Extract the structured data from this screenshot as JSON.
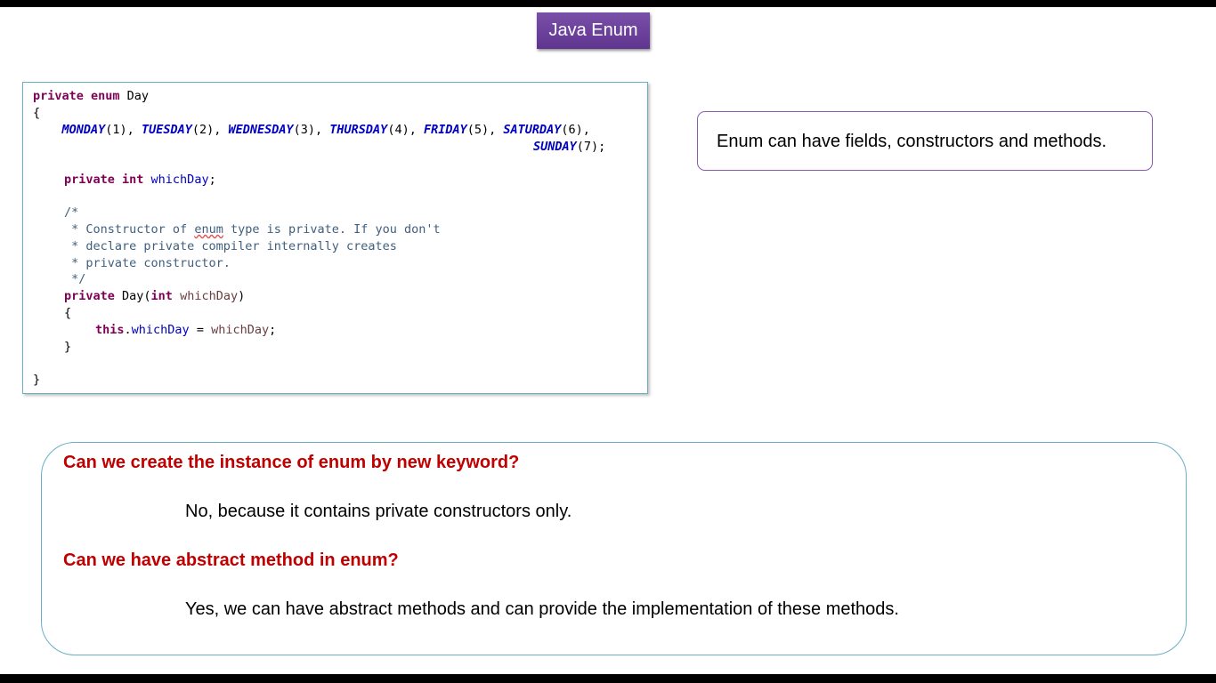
{
  "title": "Java Enum",
  "code": {
    "l01": {
      "kw": "private enum",
      "t": " Day"
    },
    "l02": "{",
    "l03": {
      "pre": "    ",
      "items": [
        {
          "name": "MONDAY",
          "arg": "(1), "
        },
        {
          "name": "TUESDAY",
          "arg": "(2), "
        },
        {
          "name": "WEDNESDAY",
          "arg": "(3), "
        },
        {
          "name": "THURSDAY",
          "arg": "(4), "
        },
        {
          "name": "FRIDAY",
          "arg": "(5), "
        },
        {
          "name": "SATURDAY",
          "arg": "(6),"
        }
      ]
    },
    "l04": {
      "name": "SUNDAY",
      "arg": "(7);"
    },
    "l05": {
      "kw": "private int",
      "field": "whichDay",
      "end": ";"
    },
    "l06": "/*",
    "l07": {
      "a": " * Constructor of ",
      "sq": "enum",
      "b": " type is private. If you don't"
    },
    "l08": " * declare private compiler internally creates",
    "l09": " * private constructor.",
    "l10": " */",
    "l11": {
      "kw": "private",
      "mid": " Day(",
      "kw2": "int",
      "param": " whichDay",
      "end": ")"
    },
    "l12": "{",
    "l13": {
      "kw": "this",
      "dot": ".",
      "field": "whichDay",
      "eq": " = ",
      "param": "whichDay",
      "end": ";"
    },
    "l14": "}",
    "l15": "}"
  },
  "note": "Enum can have fields, constructors and methods.",
  "qa": [
    {
      "question": "Can we create the instance of enum by new keyword?",
      "answer": "No, because it contains private constructors only."
    },
    {
      "question": "Can we have abstract method in enum?",
      "answer": "Yes, we can have abstract methods and can provide the implementation of these methods."
    }
  ]
}
